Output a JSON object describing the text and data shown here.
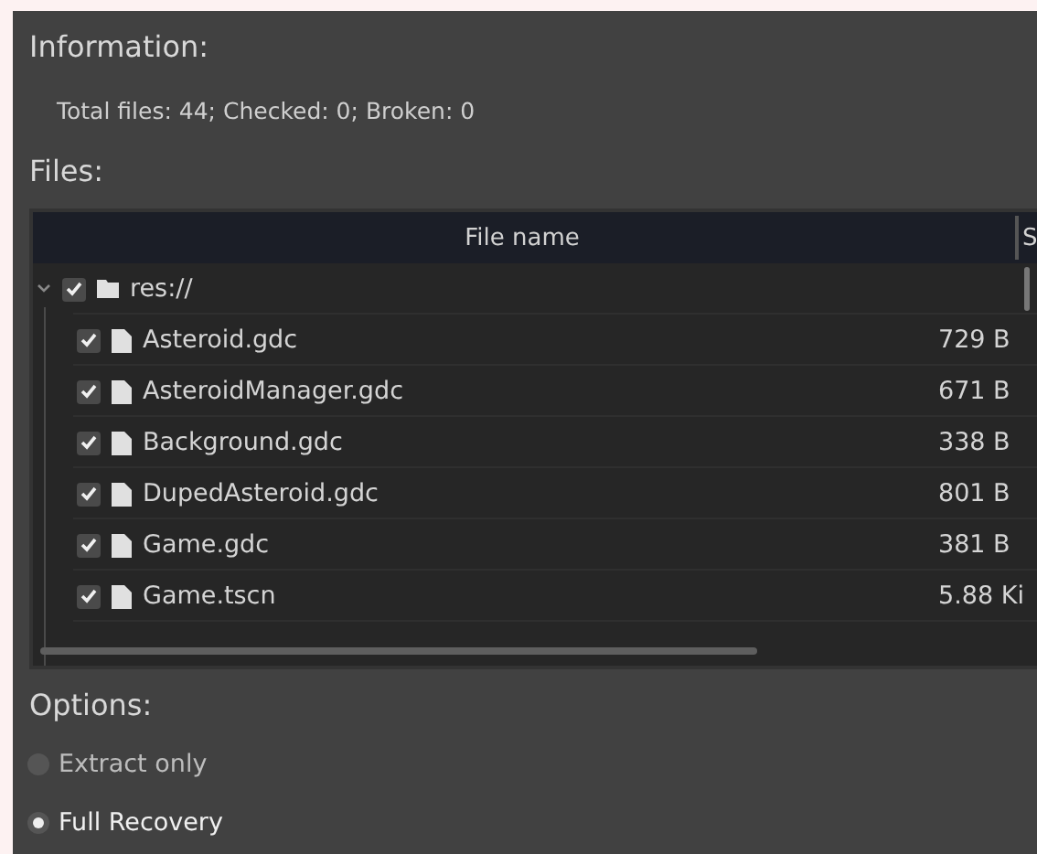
{
  "information": {
    "title": "Information:",
    "summary": "Total files: 44; Checked: 0; Broken: 0"
  },
  "files": {
    "title": "Files:",
    "columns": [
      "File name",
      "S"
    ],
    "tree": [
      {
        "name": "res://",
        "kind": "folder",
        "checked": true,
        "expanded": true,
        "children": [
          {
            "name": "Asteroid.gdc",
            "kind": "file",
            "checked": true,
            "size": "729 B"
          },
          {
            "name": "AsteroidManager.gdc",
            "kind": "file",
            "checked": true,
            "size": "671 B"
          },
          {
            "name": "Background.gdc",
            "kind": "file",
            "checked": true,
            "size": "338 B"
          },
          {
            "name": "DupedAsteroid.gdc",
            "kind": "file",
            "checked": true,
            "size": "801 B"
          },
          {
            "name": "Game.gdc",
            "kind": "file",
            "checked": true,
            "size": "381 B"
          },
          {
            "name": "Game.tscn",
            "kind": "file",
            "checked": true,
            "size": "5.88 Ki"
          }
        ]
      }
    ]
  },
  "options": {
    "title": "Options:",
    "modes": [
      {
        "label": "Extract only",
        "selected": false
      },
      {
        "label": "Full Recovery",
        "selected": true
      }
    ]
  }
}
